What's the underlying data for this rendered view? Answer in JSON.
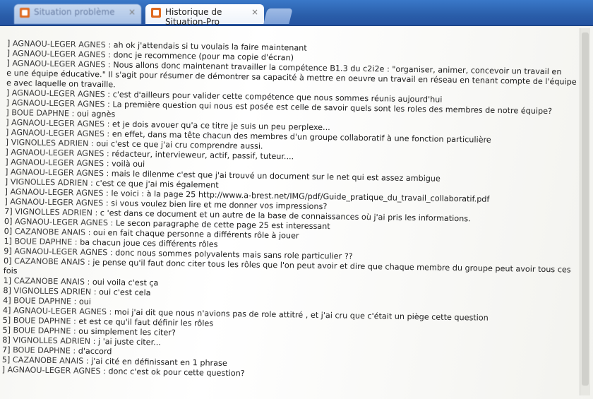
{
  "tabs": [
    {
      "title": "Situation problème",
      "active": false
    },
    {
      "title": "Historique de Situation-Pro",
      "active": true
    }
  ],
  "tab_close_glyph": "×",
  "messages": [
    {
      "prefix": "]",
      "speaker": "AGNAOU-LEGER AGNES :",
      "text": "ah ok j'attendais si tu voulais la faire maintenant"
    },
    {
      "prefix": "]",
      "speaker": "AGNAOU-LEGER AGNES :",
      "text": "donc je recommence (pour ma copie d'écran)"
    },
    {
      "prefix": "]",
      "speaker": "AGNAOU-LEGER AGNES :",
      "text": "Nous allons donc maintenant travailler la compétence B1.3 du c2i2e : \"organiser, animer, concevoir un travail en"
    },
    {
      "prefix": "",
      "speaker": "",
      "text": "e une équipe éducative.\" Il s'agit pour résumer de démontrer sa capacité à mettre en oeuvre un travail en réseau en tenant compte de l'équipe"
    },
    {
      "prefix": "",
      "speaker": "",
      "text": "e avec laquelle on travaille."
    },
    {
      "prefix": "]",
      "speaker": "AGNAOU-LEGER AGNES :",
      "text": "c'est d'ailleurs pour valider cette compétence que nous sommes réunis aujourd'hui"
    },
    {
      "prefix": "]",
      "speaker": "AGNAOU-LEGER AGNES :",
      "text": "La première question qui nous est posée est celle de savoir quels sont les roles des membres de notre équipe?"
    },
    {
      "prefix": "]",
      "speaker": "BOUE DAPHNE :",
      "text": "oui agnès"
    },
    {
      "prefix": "]",
      "speaker": "AGNAOU-LEGER AGNES :",
      "text": "et je dois avouer qu'a ce titre je suis un peu perplexe..."
    },
    {
      "prefix": "]",
      "speaker": "AGNAOU-LEGER AGNES :",
      "text": "en effet, dans ma tête chacun des membres d'un groupe collaboratif à une fonction particulière"
    },
    {
      "prefix": "]",
      "speaker": "VIGNOLLES ADRIEN :",
      "text": "oui c'est ce que j'ai cru comprendre aussi."
    },
    {
      "prefix": "]",
      "speaker": "AGNAOU-LEGER AGNES :",
      "text": "rédacteur, intervieweur, actif, passif, tuteur...."
    },
    {
      "prefix": "]",
      "speaker": "AGNAOU-LEGER AGNES :",
      "text": "voilà oui"
    },
    {
      "prefix": "]",
      "speaker": "AGNAOU-LEGER AGNES :",
      "text": "mais le dilenme c'est que j'ai trouvé un document sur le net qui est assez ambigue"
    },
    {
      "prefix": "]",
      "speaker": "VIGNOLLES ADRIEN :",
      "text": "c'est ce que j'ai mis également"
    },
    {
      "prefix": "]",
      "speaker": "AGNAOU-LEGER AGNES :",
      "text": "le voici : à la page 25 http://www.a-brest.net/IMG/pdf/Guide_pratique_du_travail_collaboratif.pdf"
    },
    {
      "prefix": "]",
      "speaker": "AGNAOU-LEGER AGNES :",
      "text": "si vous voulez bien lire et me donner vos impressions?"
    },
    {
      "prefix": "7]",
      "speaker": "VIGNOLLES ADRIEN :",
      "text": "c 'est dans ce document et un autre de la base de connaissances où j'ai pris les informations."
    },
    {
      "prefix": "0]",
      "speaker": "AGNAOU-LEGER AGNES :",
      "text": "Le secon paragraphe de cette page 25 est interessant"
    },
    {
      "prefix": "0]",
      "speaker": "CAZANOBE ANAIS :",
      "text": "oui en fait chaque personne a différents rôle à jouer"
    },
    {
      "prefix": "1]",
      "speaker": "BOUE DAPHNE :",
      "text": "ba chacun joue ces différents rôles"
    },
    {
      "prefix": "9]",
      "speaker": "AGNAOU-LEGER AGNES :",
      "text": "donc nous sommes polyvalents mais sans role particulier ??"
    },
    {
      "prefix": "0]",
      "speaker": "CAZANOBE ANAIS :",
      "text": "je pense qu'il faut donc citer tous les rôles que l'on peut avoir et dire que chaque membre du groupe peut avoir tous ces"
    },
    {
      "prefix": "",
      "speaker": "",
      "text": "fois"
    },
    {
      "prefix": "1]",
      "speaker": "CAZANOBE ANAIS :",
      "text": "oui voila c'est ça"
    },
    {
      "prefix": "8]",
      "speaker": "VIGNOLLES ADRIEN :",
      "text": "oui c'est cela"
    },
    {
      "prefix": "4]",
      "speaker": "BOUE DAPHNE :",
      "text": "oui"
    },
    {
      "prefix": "4]",
      "speaker": "AGNAOU-LEGER AGNES :",
      "text": "moi j'ai dit que nous n'avions pas de role attitré , et j'ai cru que c'était un piège cette question"
    },
    {
      "prefix": "5]",
      "speaker": "BOUE DAPHNE :",
      "text": "et est ce qu'il faut définir les rôles"
    },
    {
      "prefix": "5]",
      "speaker": "BOUE DAPHNE :",
      "text": "ou simplement les citer?"
    },
    {
      "prefix": "8]",
      "speaker": "VIGNOLLES ADRIEN :",
      "text": "j 'ai juste citer..."
    },
    {
      "prefix": "7]",
      "speaker": "BOUE DAPHNE :",
      "text": "d'accord"
    },
    {
      "prefix": "5]",
      "speaker": "CAZANOBE ANAIS :",
      "text": "j'ai cité en définissant en 1 phrase"
    },
    {
      "prefix": "]",
      "speaker": "AGNAOU-LEGER AGNES :",
      "text": "donc c'est ok pour cette question?"
    }
  ]
}
